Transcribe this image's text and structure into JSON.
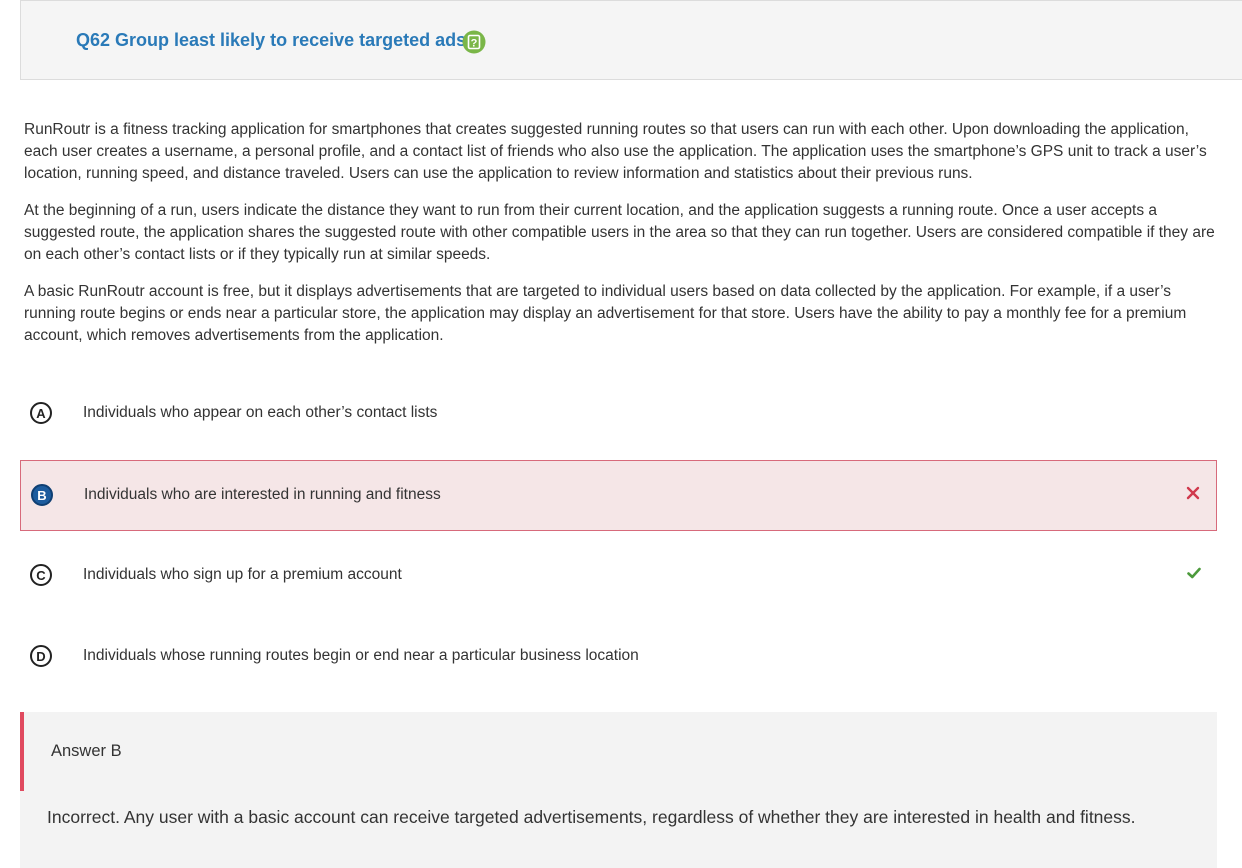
{
  "question": {
    "title": "Q62 Group least likely to receive targeted ads",
    "help_icon": "help-question-icon"
  },
  "stimulus": {
    "paragraphs": [
      "RunRoutr is a fitness tracking application for smartphones that creates suggested running routes so that users can run with each other. Upon downloading the application, each user creates a username, a personal profile, and a contact list of friends who also use the application. The application uses the smartphone’s GPS unit to track a user’s location, running speed, and distance traveled. Users can use the application to review information and statistics about their previous runs.",
      "At the beginning of a run, users indicate the distance they want to run from their current location, and the application suggests a running route. Once a user accepts a suggested route, the application shares the suggested route with other compatible users in the area so that they can run together. Users are considered compatible if they are on each other’s contact lists or if they typically run at similar speeds.",
      "A basic RunRoutr account is free, but it displays advertisements that are targeted to individual users based on data collected by the application. For example, if a user’s running route begins or ends near a particular store, the application may display an advertisement for that store. Users have the ability to pay a monthly fee for a premium account, which removes advertisements from the application."
    ]
  },
  "options": [
    {
      "letter": "A",
      "text": "Individuals who appear on each other’s contact lists"
    },
    {
      "letter": "B",
      "text": "Individuals who are interested in running and fitness",
      "selected": true,
      "mark": "close-x-icon"
    },
    {
      "letter": "C",
      "text": "Individuals who sign up for a premium account",
      "mark": "checkmark-icon"
    },
    {
      "letter": "D",
      "text": "Individuals whose running routes begin or end near a particular business location"
    }
  ],
  "feedback": {
    "title": "Answer B",
    "text": "Incorrect. Any user with a basic account can receive targeted advertisements, regardless of whether they are interested in health and fitness."
  },
  "colors": {
    "title_blue": "#2a7ab8",
    "help_green": "#7ab648",
    "wrong_red": "#d0394d",
    "correct_green": "#4c9a3c",
    "selected_bg": "#f5e6e7",
    "selected_border": "#d76a7b",
    "selected_letter_bg": "#1d5c9e",
    "feedback_bg": "#f3f3f3",
    "feedback_bar": "#e04a5f"
  }
}
